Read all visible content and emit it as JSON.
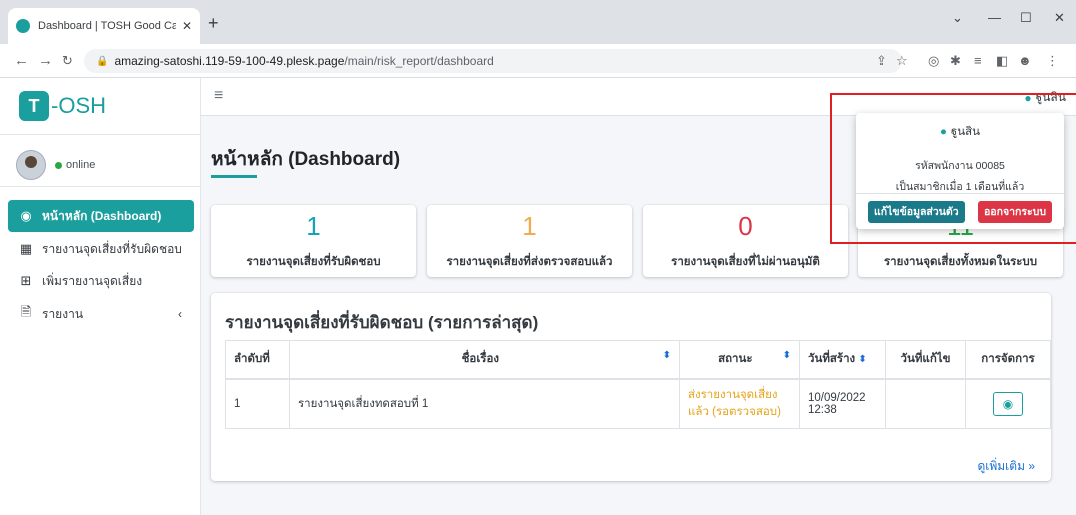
{
  "browser": {
    "tab_title": "Dashboard | TOSH Good Catch R",
    "tab_close": "✕",
    "new_tab": "+",
    "url_host": "amazing-satoshi.119-59-100-49.plesk.page",
    "url_path": "/main/risk_report/dashboard",
    "win_minimize": "—",
    "win_maximize": "☐",
    "win_close": "✕",
    "win_menu": "⌄"
  },
  "brand": {
    "mark": "T",
    "text": "-OSH",
    "color": "#1a9e9e"
  },
  "user": {
    "status": "online",
    "name": "ฐูนสิน"
  },
  "sidebar": {
    "items": [
      {
        "label": "หน้าหลัก (Dashboard)",
        "icon": "dashboard-icon",
        "glyph": "◉"
      },
      {
        "label": "รายงานจุดเสี่ยงที่รับผิดชอบ",
        "icon": "table-icon",
        "glyph": "▦"
      },
      {
        "label": "เพิ่มรายงานจุดเสี่ยง",
        "icon": "plus-square-icon",
        "glyph": "⊞"
      },
      {
        "label": "รายงาน",
        "icon": "file-icon",
        "glyph": "🗎",
        "chevron": "‹"
      }
    ]
  },
  "header": {
    "hamburger": "≡",
    "user_name": "ฐูนสิน"
  },
  "page": {
    "title": "หน้าหลัก (Dashboard)"
  },
  "stats": [
    {
      "value": "1",
      "label": "รายงานจุดเสี่ยงที่รับผิดชอบ",
      "color": "#17a2b8"
    },
    {
      "value": "1",
      "label": "รายงานจุดเสี่ยงที่ส่งตรวจสอบแล้ว",
      "color": "#f0ad4e"
    },
    {
      "value": "0",
      "label": "รายงานจุดเสี่ยงที่ไม่ผ่านอนุมัติ",
      "color": "#dc3545"
    },
    {
      "value": "11",
      "label": "รายงานจุดเสี่ยงทั้งหมดในระบบ",
      "color": "#28a745"
    }
  ],
  "card": {
    "title": "รายงานจุดเสี่ยงที่รับผิดชอบ (รายการล่าสุด)",
    "columns": [
      "ลำดับที่",
      "ชื่อเรื่อง",
      "สถานะ",
      "วันที่สร้าง",
      "วันที่แก้ไข",
      "การจัดการ"
    ],
    "rows": [
      {
        "no": "1",
        "subject": "รายงานจุดเสี่ยงทดสอบที่ 1",
        "status_line1": "ส่งรายงานจุดเสี่ยง",
        "status_line2": "แล้ว (รอตรวจสอบ)",
        "created_date": "10/09/2022",
        "created_time": "12:38",
        "modified": ""
      }
    ],
    "more_link": "ดูเพิ่มเติม »"
  },
  "dropdown": {
    "name": "ฐูนสิน",
    "employee_id": "รหัสพนักงาน 00085",
    "member_since": "เป็นสมาชิกเมื่อ 1 เดือนที่แล้ว",
    "edit_button": "แก้ไขข้อมูลส่วนตัว",
    "logout_button": "ออกจากระบบ"
  }
}
